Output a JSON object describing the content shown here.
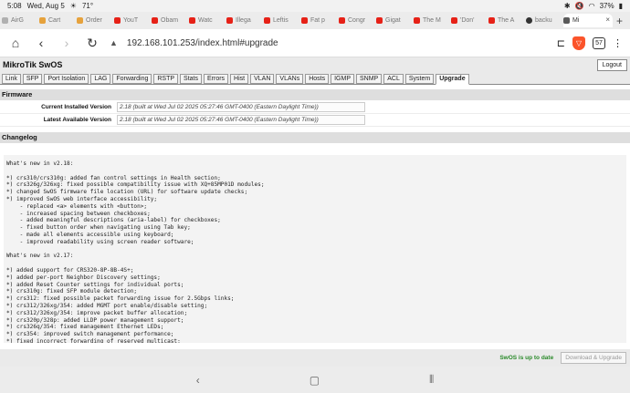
{
  "status_bar": {
    "time": "5:08",
    "date": "Wed, Aug 5",
    "temperature": "71°",
    "battery": "37%"
  },
  "tabs": [
    {
      "label": "AirG",
      "icon": "gray"
    },
    {
      "label": "Cart",
      "icon": "amber"
    },
    {
      "label": "Order",
      "icon": "amber"
    },
    {
      "label": "YouT",
      "icon": "yt"
    },
    {
      "label": "Obam",
      "icon": "yt"
    },
    {
      "label": "Watc",
      "icon": "yt"
    },
    {
      "label": "Illega",
      "icon": "yt"
    },
    {
      "label": "Leftis",
      "icon": "yt"
    },
    {
      "label": "Fat p",
      "icon": "yt"
    },
    {
      "label": "Congr",
      "icon": "yt"
    },
    {
      "label": "Gigat",
      "icon": "yt"
    },
    {
      "label": "The M",
      "icon": "yt"
    },
    {
      "label": "'Don'",
      "icon": "yt"
    },
    {
      "label": "The A",
      "icon": "yt"
    },
    {
      "label": "backu",
      "icon": "dark"
    },
    {
      "label": "Mi",
      "icon": "mt",
      "active": true
    }
  ],
  "browser": {
    "url": "192.168.101.253/index.html#upgrade",
    "tab_count": "57"
  },
  "app": {
    "title": "MikroTik SwOS",
    "logout_label": "Logout"
  },
  "menu": [
    {
      "label": "Link"
    },
    {
      "label": "SFP"
    },
    {
      "label": "Port Isolation"
    },
    {
      "label": "LAG"
    },
    {
      "label": "Forwarding"
    },
    {
      "label": "RSTP"
    },
    {
      "label": "Stats"
    },
    {
      "label": "Errors"
    },
    {
      "label": "Hist"
    },
    {
      "label": "VLAN"
    },
    {
      "label": "VLANs"
    },
    {
      "label": "Hosts"
    },
    {
      "label": "IGMP"
    },
    {
      "label": "SNMP"
    },
    {
      "label": "ACL"
    },
    {
      "label": "System"
    },
    {
      "label": "Upgrade",
      "active": true
    }
  ],
  "firmware": {
    "section_title": "Firmware",
    "current_label": "Current Installed Version",
    "current_value": "2.18 (built at Wed Jul 02 2025 05:27:46 GMT-0400 (Eastern Daylight Time))",
    "latest_label": "Latest Available Version",
    "latest_value": "2.18 (built at Wed Jul 02 2025 05:27:46 GMT-0400 (Eastern Daylight Time))"
  },
  "changelog": {
    "section_title": "Changelog",
    "text": "What's new in v2.18:\n\n*) crs310/crs310g: added fan control settings in Health section;\n*) crs326g/326xg: fixed possible compatibility issue with XQ+85MP01D modules;\n*) changed SwOS firmware file location (URL) for software update checks;\n*) improved SwOS web interface accessibility;\n    - replaced <a> elements with <button>;\n    - increased spacing between checkboxes;\n    - added meaningful descriptions (aria-label) for checkboxes;\n    - fixed button order when navigating using Tab key;\n    - made all elements accessible using keyboard;\n    - improved readability using screen reader software;\n\nWhat's new in v2.17:\n\n*) added support for CRS320-8P-8B-4S+;\n*) added per-port Neighbor Discovery settings;\n*) added Reset Counter settings for individual ports;\n*) crs310g: fixed SFP module detection;\n*) crs312: fixed possible packet forwarding issue for 2.5Gbps links;\n*) crs312/326xg/354: added MGMT port enable/disable setting;\n*) crs312/326xg/354: improve packet buffer allocation;\n*) crs320p/328p: added LLDP power management support;\n*) crs326q/354: fixed management Ethernet LEDs;\n*) crs354: improved switch management performance;\n*) fixed incorrect forwarding of reserved multicast;\n*) fixed neighbor discovery from WinBox;\n*) improved fan control based on temperature;"
  },
  "footer": {
    "status_text": "SwOS is up to date",
    "download_label": "Download & Upgrade"
  },
  "android_nav": {
    "back": "‹",
    "home": "▢",
    "recents": "⦀"
  }
}
